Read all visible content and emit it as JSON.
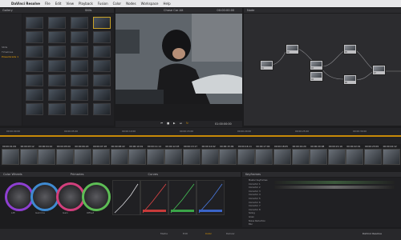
{
  "app": {
    "name": "DaVinci Resolve",
    "menu": [
      "DaVinci Resolve",
      "File",
      "Edit",
      "View",
      "Playback",
      "Fusion",
      "Color",
      "Nodes",
      "Workspace",
      "Help"
    ],
    "brand_bottom_right": "DaVinci Resolve"
  },
  "panels": {
    "gallery_label": "Gallery",
    "gallery_sub": "Stills",
    "viewer_title": "Chase Car Alt",
    "viewer_timecode": "00:00:00:00",
    "node_label": "Node",
    "timeline_timecode": "01:27:03:03",
    "viewer_out_timecode": "01:00:00:00",
    "ruler": [
      "00:00:00:00",
      "00:00:05:00",
      "00:00:10:00",
      "00:00:15:00",
      "00:00:20:00",
      "00:00:25:00",
      "00:00:30:00"
    ]
  },
  "albums": [
    "Stills",
    "Timelines",
    "PowerGrade 1"
  ],
  "color_tabs": [
    "Color Wheels",
    "Primaries",
    "Curves",
    "Keyframes"
  ],
  "wheels": [
    "Lift",
    "Gamma",
    "Gain",
    "Offset"
  ],
  "curves": [
    "Luminance",
    "Red",
    "Green",
    "Blue"
  ],
  "keyframes": [
    "Master Keyframes",
    "Corrector 1",
    "Corrector 2",
    "Corrector 3",
    "Corrector 4",
    "Corrector 5",
    "Corrector 6",
    "Corrector 7",
    "Corrector 8",
    "Sizing",
    "Grain",
    "Noise Reduction",
    "Blur"
  ],
  "nodes": [
    "01",
    "02",
    "03",
    "04",
    "05",
    "06",
    "07",
    "08",
    "09"
  ],
  "clips": [
    {
      "tc": "00:00:01:09"
    },
    {
      "tc": "00:00:03:12"
    },
    {
      "tc": "00:00:04:10"
    },
    {
      "tc": "00:00:05:00"
    },
    {
      "tc": "00:00:06:20"
    },
    {
      "tc": "00:00:07:18"
    },
    {
      "tc": "00:00:08:22"
    },
    {
      "tc": "00:00:10:01"
    },
    {
      "tc": "00:00:11:14"
    },
    {
      "tc": "00:00:12:03"
    },
    {
      "tc": "00:00:13:17"
    },
    {
      "tc": "00:00:14:02"
    },
    {
      "tc": "00:00:15:09"
    },
    {
      "tc": "00:00:16:11"
    },
    {
      "tc": "00:00:17:00"
    },
    {
      "tc": "00:00:18:05"
    },
    {
      "tc": "00:00:19:20"
    },
    {
      "tc": "00:00:20:08"
    },
    {
      "tc": "00:00:21:16"
    },
    {
      "tc": "00:00:22:01"
    },
    {
      "tc": "00:00:23:09"
    },
    {
      "tc": "00:00:24:12"
    }
  ],
  "bottom_tabs": [
    "Media",
    "Edit",
    "Color",
    "Deliver"
  ],
  "active_bottom_tab": "Color",
  "colors": {
    "accent": "#f0a300",
    "selection": "#c9a227",
    "wheel_ring": "#8e3fd1"
  }
}
